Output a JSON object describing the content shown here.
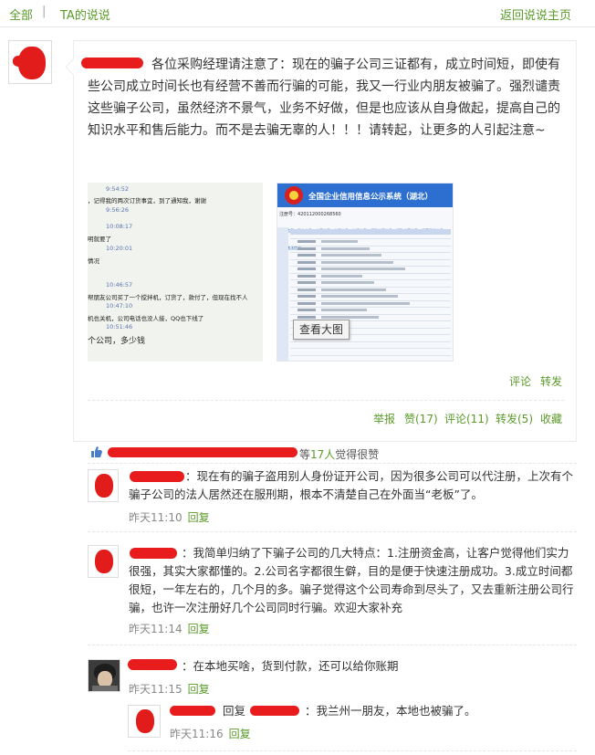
{
  "nav": {
    "all": "全部",
    "sep": "|",
    "ta_posts": "TA的说说",
    "back": "返回说说主页"
  },
  "post": {
    "text": "各位采购经理请注意了：现在的骗子公司三证都有，成立时间短，即使有些公司成立时间长也有经营不善而行骗的可能，我又一行业内朋友被骗了。强烈谴责这些骗子公司，虽然经济不景气，业务不好做，但是也应该从自身做起，提高自己的知识水平和售后能力。而不是去骗无辜的人！！！请转起，让更多的人引起注意~",
    "view_large": "查看大图",
    "image1_lines": [
      {
        "t": "9:54:52",
        "ts": true
      },
      {
        "t": "，记得我的两次订货事宜，到了通知我，谢谢",
        "ts": false
      },
      {
        "t": "9:56:26",
        "ts": true
      },
      {
        "t": "10:08:17",
        "ts": true
      },
      {
        "t": "明就要了",
        "ts": false
      },
      {
        "t": "10:20:01",
        "ts": true
      },
      {
        "t": "情况",
        "ts": false
      },
      {
        "t": "10:46:57",
        "ts": true
      },
      {
        "t": "帮朋友公司买了一个搅拌机，订货了，款付了，但现在找不人",
        "ts": false
      },
      {
        "t": "10:47:10",
        "ts": true
      },
      {
        "t": "机也关机，公司电话也没人接，QQ也下线了",
        "ts": false
      },
      {
        "t": "10:51:46",
        "ts": true
      },
      {
        "t": "个公司，多少钱",
        "ts": false
      }
    ],
    "image2": {
      "title": "全国企业信用信息公示系统（湖北）",
      "reg_number_label": "注册号：",
      "reg_number": "420112000268560",
      "tabs": [
        "基本信息",
        "股东信息",
        "变更信息",
        "出资信息",
        "年报信息",
        "行政许可信息",
        "行政处罚信息",
        "经营异常信息",
        "严重违法信息"
      ]
    },
    "actions_inline": {
      "comment": "评论",
      "forward": "转发"
    },
    "actions": {
      "report": "举报",
      "like": "赞(17)",
      "comment": "评论(11)",
      "forward": "转发(5)",
      "favorite": "收藏"
    }
  },
  "likes": {
    "prefix": "等",
    "count": "17人",
    "suffix": "觉得很赞"
  },
  "comments": [
    {
      "text": "：现在有的骗子盗用别人身份证开公司，因为很多公司可以代注册，上次有个骗子公司的法人居然还在服刑期，根本不清楚自己在外面当“老板”了。",
      "time": "昨天11:10",
      "reply": "回复"
    },
    {
      "text": "：我简单归纳了下骗子公司的几大特点：1.注册资金高，让客户觉得他们实力很强，其实大家都懂的。2.公司名字都很生僻，目的是便于快速注册成功。3.成立时间都很短，一年左右的，几个月的多。骗子觉得这个公司寿命到尽头了，又去重新注册公司行骗，也许一次注册好几个公司同时行骗。欢迎大家补充",
      "time": "昨天11:14",
      "reply": "回复"
    },
    {
      "text": "：在本地买啥，货到付款，还可以给你账期",
      "time": "昨天11:15",
      "reply": "回复"
    }
  ],
  "sub_reply": {
    "label": "回复",
    "text": "：我兰州一朋友，本地也被骗了。",
    "time": "昨天11:16",
    "reply": "回复"
  },
  "colors": {
    "accent": "#5a9a2a",
    "redaction": "#e81c1c"
  }
}
